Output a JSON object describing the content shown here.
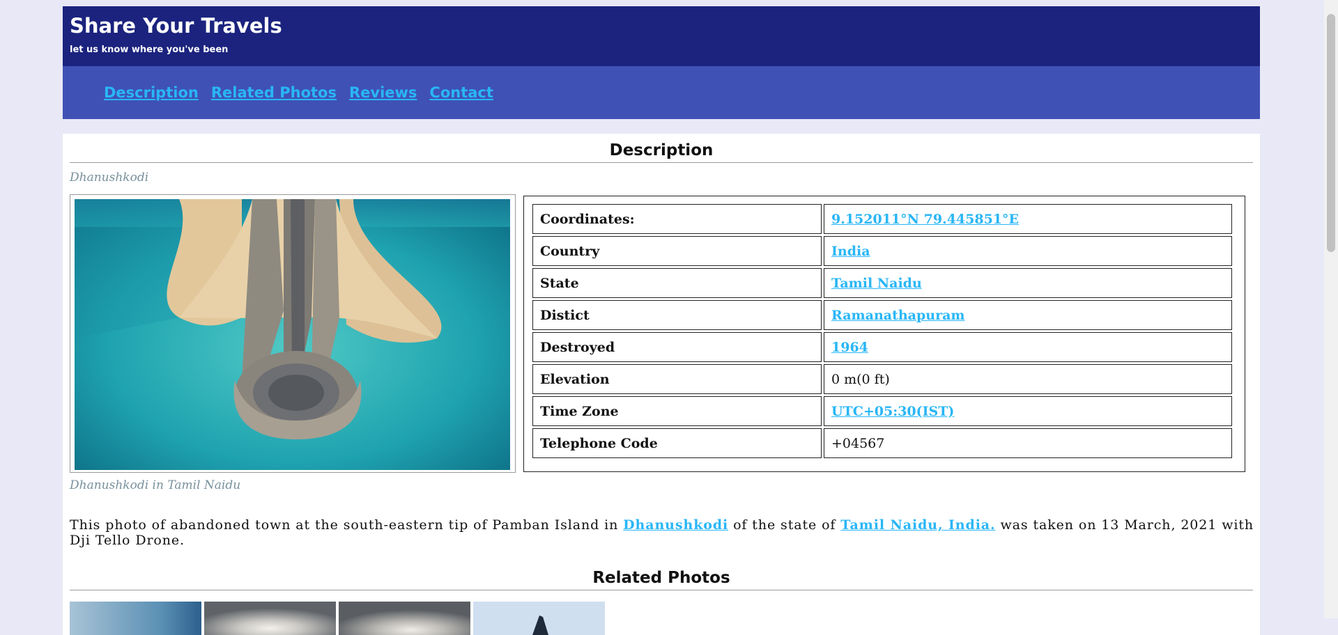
{
  "header": {
    "title": "Share Your Travels",
    "tagline": "let us know where you've been"
  },
  "nav": {
    "items": [
      "Description",
      "Related Photos",
      "Reviews",
      "Contact"
    ]
  },
  "description_section": {
    "heading": "Description",
    "subtitle": "Dhanushkodi",
    "photo_caption": "Dhanushkodi in Tamil Naidu",
    "facts": [
      {
        "label": "Coordinates:",
        "value": "9.152011°N 79.445851°E",
        "link": true
      },
      {
        "label": "Country",
        "value": "India",
        "link": true
      },
      {
        "label": "State",
        "value": "Tamil Naidu",
        "link": true
      },
      {
        "label": "Distict",
        "value": "Ramanathapuram",
        "link": true
      },
      {
        "label": "Destroyed",
        "value": "1964",
        "link": true
      },
      {
        "label": "Elevation",
        "value": "0 m(0 ft)",
        "link": false
      },
      {
        "label": "Time Zone",
        "value": "UTC+05:30(IST)",
        "link": true
      },
      {
        "label": "Telephone Code",
        "value": "+04567",
        "link": false
      }
    ],
    "paragraph": {
      "part1": "This photo of abandoned town at the south-eastern tip of Pamban Island in ",
      "link1": "Dhanushkodi",
      "part2": " of the state of ",
      "link2": "Tamil Naidu, India.",
      "part3": " was taken on 13 March, 2021 with Dji Tello Drone."
    }
  },
  "related_section": {
    "heading": "Related Photos"
  },
  "colors": {
    "header_bg": "#1b237e",
    "nav_bg": "#3f51b5",
    "link": "#29b6f6",
    "page_bg": "#e8e8f6"
  }
}
